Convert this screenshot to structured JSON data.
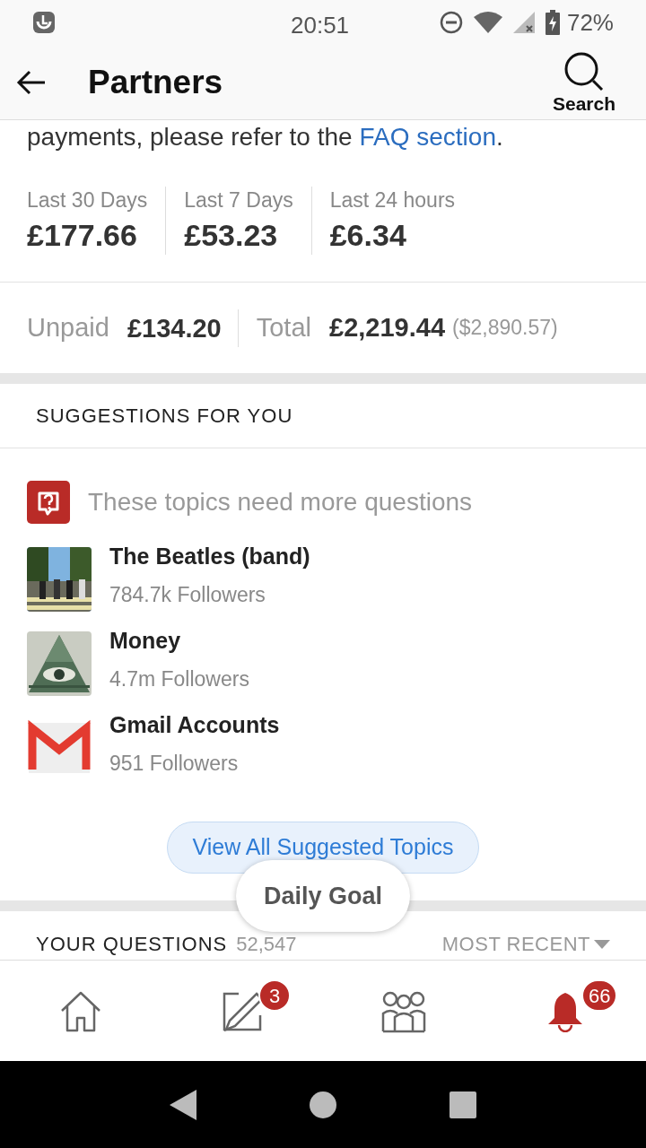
{
  "status_bar": {
    "time": "20:51",
    "battery": "72%"
  },
  "header": {
    "title": "Partners",
    "search_label": "Search"
  },
  "intro": {
    "text": "payments, please refer to the ",
    "link": "FAQ section",
    "end": "."
  },
  "stats": [
    {
      "label": "Last 30 Days",
      "value": "£177.66"
    },
    {
      "label": "Last 7 Days",
      "value": "£53.23"
    },
    {
      "label": "Last 24 hours",
      "value": "£6.34"
    }
  ],
  "balance": {
    "unpaid_label": "Unpaid",
    "unpaid": "£134.20",
    "total_label": "Total",
    "total": "£2,219.44",
    "total_usd": "($2,890.57)"
  },
  "suggestions": {
    "heading": "SUGGESTIONS FOR YOU",
    "prompt": "These topics need more questions",
    "topics": [
      {
        "kind": "street",
        "name": "The Beatles (band)",
        "followers": "784.7k Followers"
      },
      {
        "kind": "pyramid",
        "name": "Money",
        "followers": "4.7m Followers"
      },
      {
        "kind": "mail",
        "name": "Gmail Accounts",
        "followers": "951 Followers"
      }
    ],
    "button": "View All Suggested Topics"
  },
  "daily_goal": "Daily Goal",
  "questions": {
    "heading": "YOUR QUESTIONS",
    "count": "52,547",
    "sort": "MOST RECENT"
  },
  "nav": [
    {
      "kind": "home",
      "selected": false
    },
    {
      "kind": "write",
      "selected": false,
      "badge": "3"
    },
    {
      "kind": "people",
      "selected": false
    },
    {
      "kind": "bell",
      "selected": true,
      "badge": "66"
    }
  ]
}
